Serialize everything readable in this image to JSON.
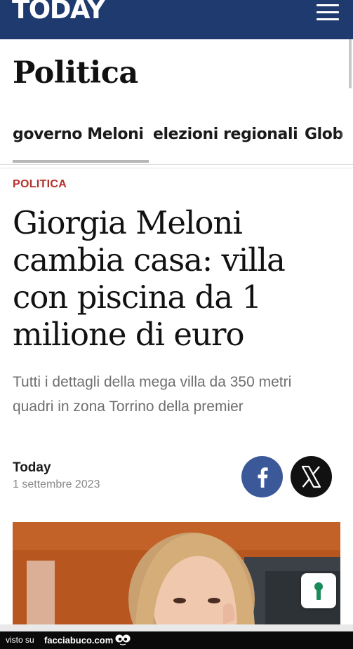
{
  "header": {
    "logo_text": "TODAY",
    "menu_icon": "hamburger-menu-icon",
    "background_color": "#1e3a6e"
  },
  "section": {
    "title": "Politica"
  },
  "topics": {
    "tabs": [
      "governo Meloni",
      "elezioni regionali",
      "Glob"
    ],
    "active_index": 0
  },
  "article": {
    "kicker": "POLITICA",
    "kicker_color": "#b5302a",
    "headline": "Giorgia Meloni cambia casa: villa con piscina da 1 milione di euro",
    "subtitle": "Tutti i dettagli della mega villa da 350 metri quadri in zona Torrino della premier",
    "author": "Today",
    "date": "1 settembre 2023"
  },
  "share": {
    "facebook_icon": "facebook-icon",
    "facebook_color": "#3b5998",
    "x_icon": "x-logo-icon",
    "x_color": "#111111"
  },
  "privacy_button": {
    "icon": "keyhole-shield-icon",
    "color": "#1a8a5a"
  },
  "watermark": {
    "prefix": "visto su",
    "site": "facciabuco.com"
  }
}
